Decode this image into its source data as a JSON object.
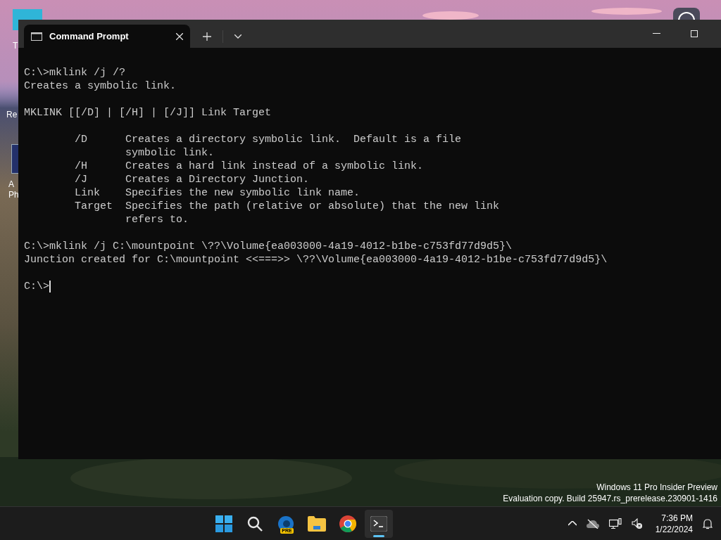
{
  "desktop": {
    "icons": [
      {
        "label": "T"
      },
      {
        "label": "Re"
      },
      {
        "label": "A\nPh"
      }
    ]
  },
  "window": {
    "tabs": [
      {
        "title": "Command Prompt",
        "selected": true
      }
    ]
  },
  "terminal": {
    "blocks": [
      {
        "lines": [
          "C:\\>mklink /j /?",
          "Creates a symbolic link."
        ]
      },
      {
        "lines": [
          "MKLINK [[/D] | [/H] | [/J]] Link Target"
        ]
      },
      {
        "lines": [
          "        /D      Creates a directory symbolic link.  Default is a file",
          "                symbolic link.",
          "        /H      Creates a hard link instead of a symbolic link.",
          "        /J      Creates a Directory Junction.",
          "        Link    Specifies the new symbolic link name.",
          "        Target  Specifies the path (relative or absolute) that the new link",
          "                refers to."
        ]
      },
      {
        "lines": [
          "C:\\>mklink /j C:\\mountpoint \\??\\Volume{ea003000-4a19-4012-b1be-c753fd77d9d5}\\",
          "Junction created for C:\\mountpoint <<===>> \\??\\Volume{ea003000-4a19-4012-b1be-c753fd77d9d5}\\"
        ]
      },
      {
        "lines": [
          "C:\\>"
        ],
        "cursor": true
      }
    ]
  },
  "watermark_os": [
    "Windows 11 Pro Insider Preview",
    "Evaluation copy. Build 25947.rs_prerelease.230901-1416"
  ],
  "taskbar": {
    "apps": [
      {
        "kind": "start",
        "selected": false
      },
      {
        "kind": "search",
        "selected": false
      },
      {
        "kind": "edge",
        "badge": "PRE",
        "selected": false
      },
      {
        "kind": "explorer",
        "selected": false
      },
      {
        "kind": "chrome",
        "selected": false
      },
      {
        "kind": "terminal",
        "selected": true
      }
    ],
    "tray": {
      "time": "7:36 PM",
      "date": "1/22/2024"
    }
  }
}
